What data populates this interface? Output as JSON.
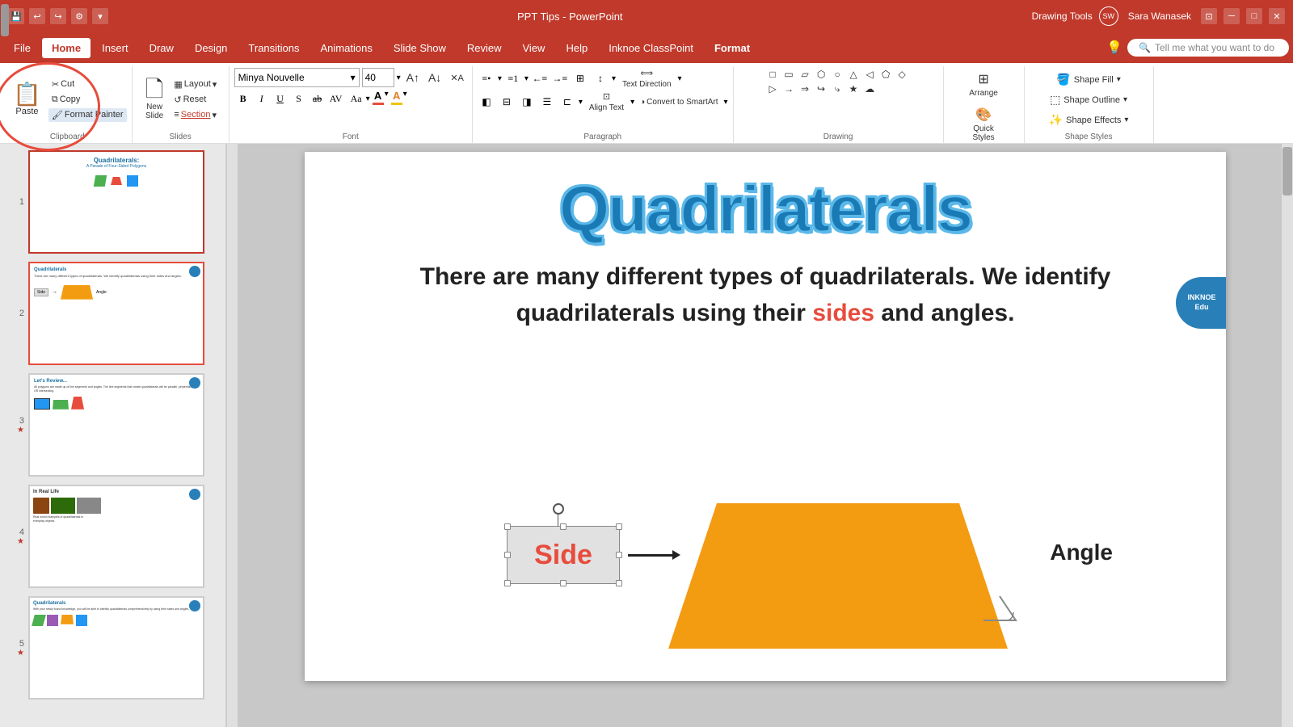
{
  "titlebar": {
    "title": "PPT Tips - PowerPoint",
    "save_icon": "💾",
    "undo_icon": "↩",
    "redo_icon": "↪",
    "user": "Sara Wanasek",
    "user_initials": "SW",
    "drawing_tools_label": "Drawing Tools"
  },
  "menubar": {
    "items": [
      "File",
      "Home",
      "Insert",
      "Draw",
      "Design",
      "Transitions",
      "Animations",
      "Slide Show",
      "Review",
      "View",
      "Help",
      "Inknoe ClassPoint",
      "Format"
    ],
    "active": "Home",
    "tell_me": "Tell me what you want to do"
  },
  "ribbon": {
    "clipboard": {
      "label": "Clipboard",
      "paste_label": "Paste",
      "cut_label": "Cut",
      "copy_label": "Copy",
      "format_painter_label": "Format Painter"
    },
    "slides": {
      "label": "Slides",
      "new_label": "New\nSlide",
      "layout_label": "Layout",
      "reset_label": "Reset",
      "section_label": "Section"
    },
    "font": {
      "label": "Font",
      "font_name": "Minya Nouvelle",
      "font_size": "40",
      "bold": "B",
      "italic": "I",
      "underline": "U",
      "shadow": "S",
      "strikethrough": "ab",
      "font_color_label": "A",
      "highlight_label": "A"
    },
    "paragraph": {
      "label": "Paragraph",
      "text_direction_label": "Text Direction",
      "align_text_label": "Align Text",
      "convert_smartart_label": "Convert to SmartArt"
    },
    "drawing": {
      "label": "Drawing",
      "arrange_label": "Arrange",
      "quick_styles_label": "Quick\nStyles"
    },
    "shape_format": {
      "shape_fill_label": "Shape Fill",
      "shape_outline_label": "Shape Outline",
      "shape_effects_label": "Shape Effects"
    }
  },
  "slides": [
    {
      "num": "1",
      "star": "",
      "title": "Quadrilaterals:",
      "subtitle": "A Parade of Four-Sided Polygons",
      "active": true
    },
    {
      "num": "2",
      "star": "",
      "title": "Quadrilaterals",
      "active": false
    },
    {
      "num": "3",
      "star": "★",
      "title": "Let's Review...",
      "active": false
    },
    {
      "num": "4",
      "star": "★",
      "title": "In Real Life",
      "active": false
    },
    {
      "num": "5",
      "star": "★",
      "title": "Quadrilaterals",
      "active": false
    }
  ],
  "canvas": {
    "title": "Quadrilaterals",
    "body_text": "There are many different types of quadrilaterals. We identify quadrilaterals using their",
    "highlight_word": "sides",
    "body_end": "and angles.",
    "side_label": "Side",
    "angle_label": "Angle"
  },
  "inknoe": {
    "label": "INKNOE\nEdu"
  }
}
